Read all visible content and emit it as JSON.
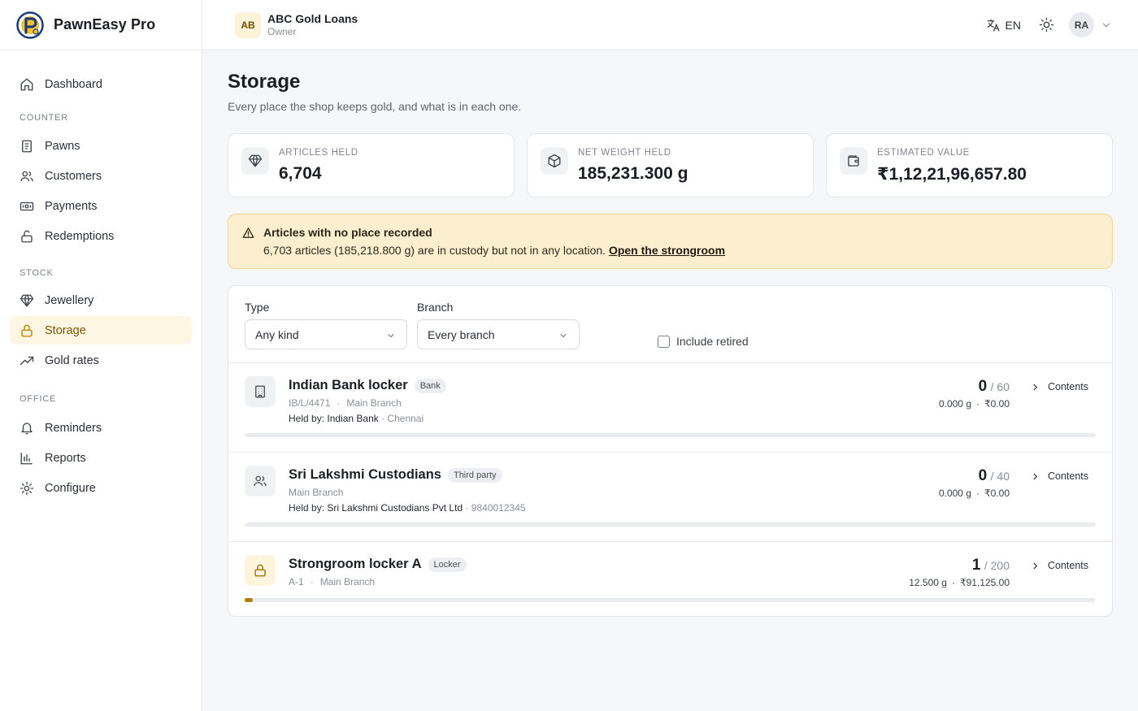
{
  "brand": {
    "name": "PawnEasy Pro",
    "logo_icon": "pawneasy-logo"
  },
  "org": {
    "badge": "AB",
    "name": "ABC Gold Loans",
    "role": "Owner"
  },
  "topbar": {
    "language": "EN",
    "avatar": "RA"
  },
  "nav": {
    "dashboard": "Dashboard",
    "sections": [
      {
        "title": "COUNTER",
        "items": [
          "Pawns",
          "Customers",
          "Payments",
          "Redemptions"
        ]
      },
      {
        "title": "STOCK",
        "items": [
          "Jewellery",
          "Storage",
          "Gold rates"
        ]
      },
      {
        "title": "OFFICE",
        "items": [
          "Reminders",
          "Reports",
          "Configure"
        ]
      }
    ],
    "active": "Storage"
  },
  "page": {
    "title": "Storage",
    "subtitle": "Every place the shop keeps gold, and what is in each one."
  },
  "stats": [
    {
      "label": "ARTICLES HELD",
      "value": "6,704",
      "icon": "gem-icon"
    },
    {
      "label": "NET WEIGHT HELD",
      "value": "185,231.300 g",
      "icon": "box-icon"
    },
    {
      "label": "ESTIMATED VALUE",
      "value": "₹1,12,21,96,657.80",
      "icon": "wallet-icon"
    }
  ],
  "alert": {
    "title": "Articles with no place recorded",
    "body": "6,703 articles (185,218.800 g) are in custody but not in any location.",
    "link": "Open the strongroom"
  },
  "filters": {
    "type_label": "Type",
    "type_value": "Any kind",
    "branch_label": "Branch",
    "branch_value": "Every branch",
    "retired_label": "Include retired"
  },
  "locations": [
    {
      "name": "Indian Bank locker",
      "badge": "Bank",
      "code": "IB/L/4471",
      "branch": "Main Branch",
      "held_label": "Held by:",
      "held_by": "Indian Bank",
      "held_extra": "Chennai",
      "count": "0",
      "capacity": "/ 60",
      "weight": "0.000 g",
      "value": "₹0.00",
      "fill": 0,
      "action": "Contents",
      "icon": "building-icon"
    },
    {
      "name": "Sri Lakshmi Custodians",
      "badge": "Third party",
      "code": "",
      "branch": "Main Branch",
      "held_label": "Held by:",
      "held_by": "Sri Lakshmi Custodians Pvt Ltd",
      "held_extra": "9840012345",
      "count": "0",
      "capacity": "/ 40",
      "weight": "0.000 g",
      "value": "₹0.00",
      "fill": 0,
      "action": "Contents",
      "icon": "users-icon"
    },
    {
      "name": "Strongroom locker A",
      "badge": "Locker",
      "code": "A-1",
      "branch": "Main Branch",
      "held_label": "",
      "held_by": "",
      "held_extra": "",
      "count": "1",
      "capacity": "/ 200",
      "weight": "12.500 g",
      "value": "₹91,125.00",
      "fill": 0.005,
      "action": "Contents",
      "icon": "lock-icon"
    }
  ],
  "colors": {
    "accent": "#b07d08",
    "active_bg": "#fdf6e3",
    "alert_bg": "#fcefcf"
  }
}
